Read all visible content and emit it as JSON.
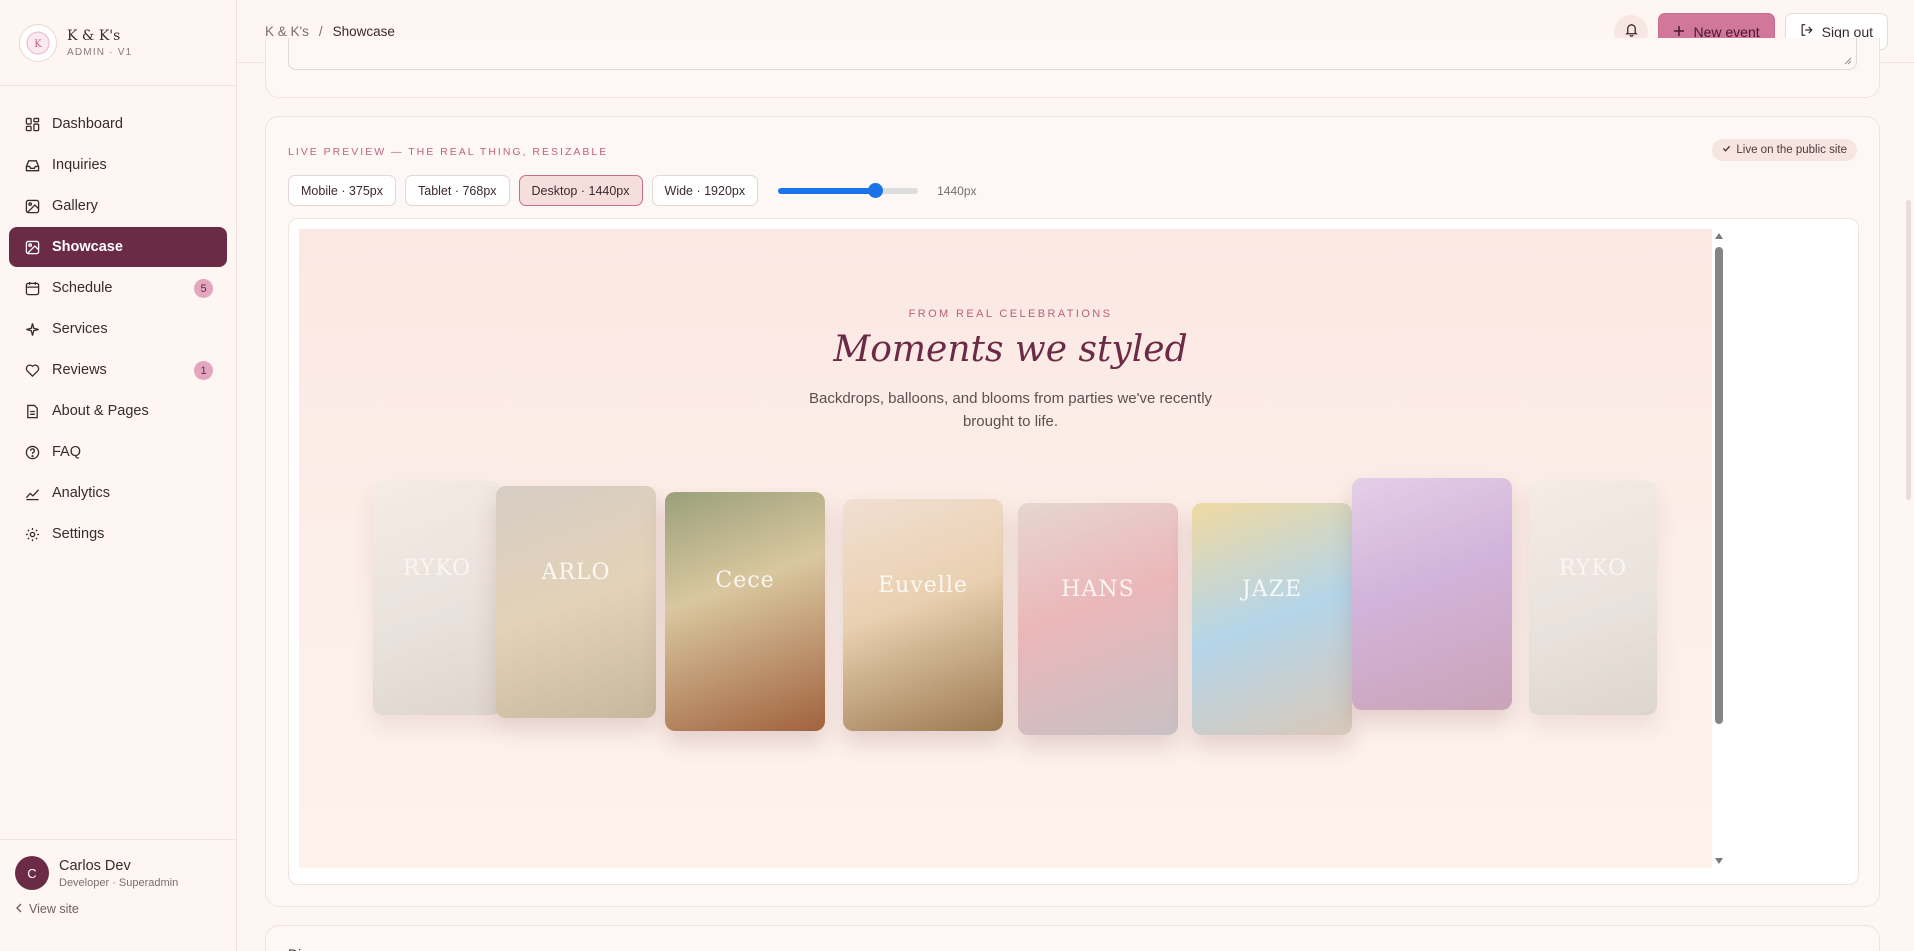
{
  "brand": {
    "name": "K & K's",
    "subtitle": "ADMIN · V1"
  },
  "nav": [
    {
      "label": "Dashboard",
      "icon": "dashboard-icon"
    },
    {
      "label": "Inquiries",
      "icon": "inbox-icon"
    },
    {
      "label": "Gallery",
      "icon": "image-icon"
    },
    {
      "label": "Showcase",
      "icon": "showcase-icon",
      "active": true
    },
    {
      "label": "Schedule",
      "icon": "calendar-icon",
      "badge": "5"
    },
    {
      "label": "Services",
      "icon": "sparkle-icon"
    },
    {
      "label": "Reviews",
      "icon": "heart-icon",
      "badge": "1"
    },
    {
      "label": "About & Pages",
      "icon": "document-icon"
    },
    {
      "label": "FAQ",
      "icon": "help-icon"
    },
    {
      "label": "Analytics",
      "icon": "chart-icon"
    },
    {
      "label": "Settings",
      "icon": "gear-icon"
    }
  ],
  "user": {
    "initial": "C",
    "name": "Carlos Dev",
    "role": "Developer · Superadmin",
    "view_site": "View site"
  },
  "breadcrumb": {
    "root": "K & K's",
    "separator": "/",
    "current": "Showcase"
  },
  "actions": {
    "new_event": "New event",
    "sign_out": "Sign out"
  },
  "preview": {
    "label": "LIVE PREVIEW — THE REAL THING, RESIZABLE",
    "status": "Live on the public site",
    "viewports": [
      {
        "label": "Mobile · 375px"
      },
      {
        "label": "Tablet · 768px"
      },
      {
        "label": "Desktop · 1440px",
        "active": true
      },
      {
        "label": "Wide · 1920px"
      }
    ],
    "width_fraction": 0.69,
    "width_label": "1440px",
    "eyebrow": "FROM REAL CELEBRATIONS",
    "title": "Moments we styled",
    "desc_line1": "Backdrops, balloons, and blooms from parties we've recently",
    "desc_line2": "brought to life.",
    "photos": [
      {
        "name": "showcase-photo-ryko",
        "text": "RYKO"
      },
      {
        "name": "showcase-photo-arlo",
        "text": "ARLO"
      },
      {
        "name": "showcase-photo-cece",
        "text": "Cece"
      },
      {
        "name": "showcase-photo-eunice",
        "text": "Euvelle"
      },
      {
        "name": "showcase-photo-hans",
        "text": "HANS"
      },
      {
        "name": "showcase-photo-jaze",
        "text": "JAZE"
      },
      {
        "name": "showcase-photo-purple-hall",
        "text": ""
      },
      {
        "name": "showcase-photo-ryko-2",
        "text": "RYKO"
      }
    ]
  },
  "next_section_initial": "Di"
}
